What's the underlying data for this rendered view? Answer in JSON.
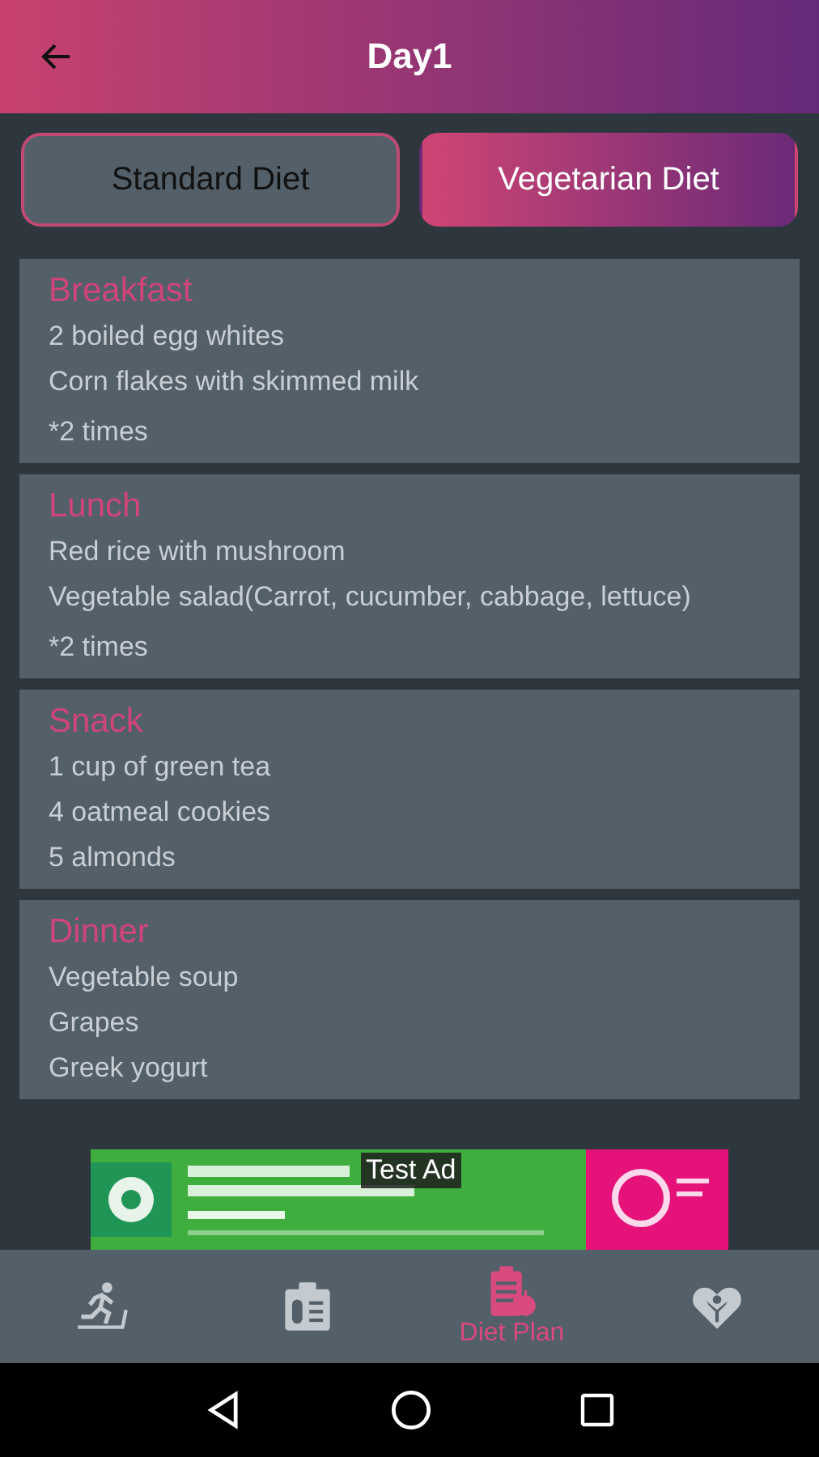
{
  "header": {
    "title": "Day1"
  },
  "tabs": [
    {
      "label": "Standard Diet",
      "selected": false
    },
    {
      "label": "Vegetarian Diet",
      "selected": true
    }
  ],
  "meals": [
    {
      "title": "Breakfast",
      "items": [
        "2 boiled egg whites",
        "Corn flakes with skimmed milk"
      ],
      "note": "*2 times"
    },
    {
      "title": "Lunch",
      "items": [
        "Red rice with mushroom",
        "Vegetable salad(Carrot, cucumber, cabbage, lettuce)"
      ],
      "note": "*2 times"
    },
    {
      "title": "Snack",
      "items": [
        "1 cup of green tea",
        "4 oatmeal cookies",
        "5 almonds"
      ]
    },
    {
      "title": "Dinner",
      "items": [
        "Vegetable soup",
        "Grapes",
        "Greek yogurt"
      ]
    }
  ],
  "ad": {
    "label": "Test Ad"
  },
  "bottom_nav": [
    {
      "kind": "exercise",
      "selected": false
    },
    {
      "kind": "clipboard",
      "selected": false
    },
    {
      "kind": "diet",
      "label": "Diet Plan",
      "selected": true
    },
    {
      "kind": "heart",
      "selected": false
    }
  ]
}
